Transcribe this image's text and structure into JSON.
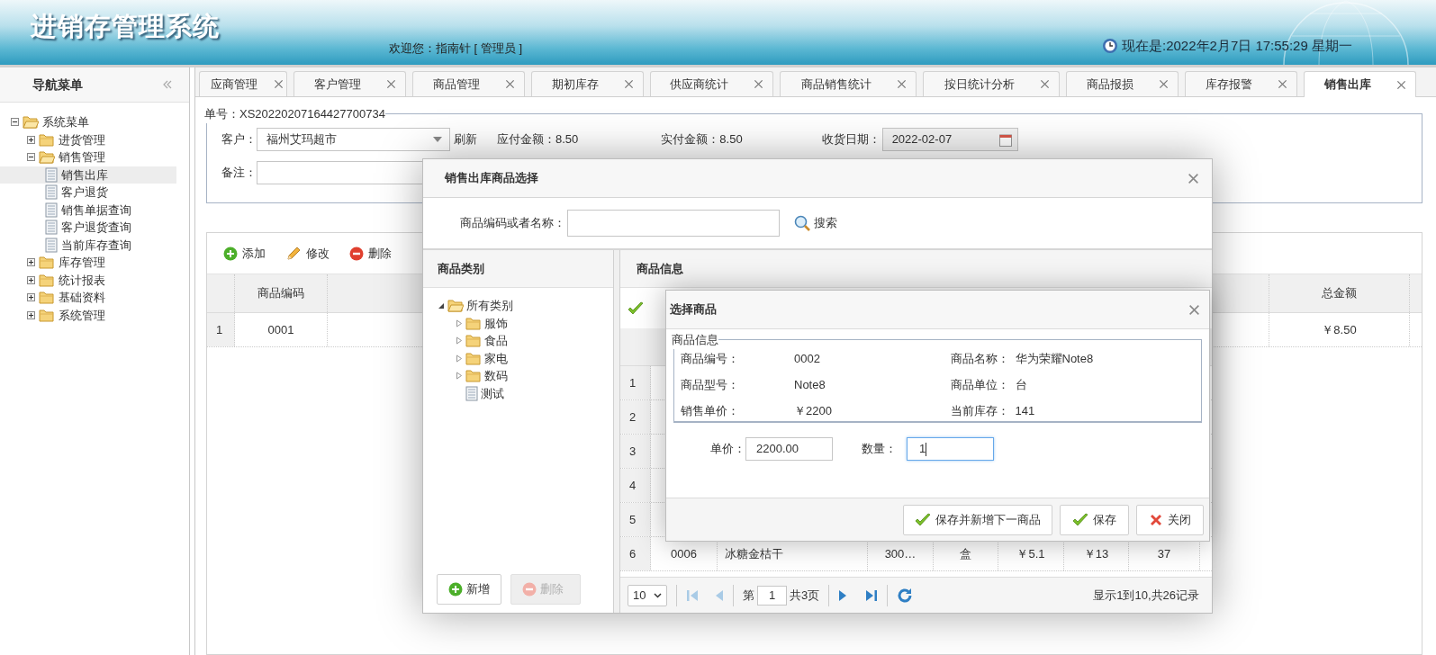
{
  "header": {
    "title": "进销存管理系统",
    "welcome": "欢迎您：指南针 [ 管理员 ]",
    "clock": "现在是:2022年2月7日 17:55:29 星期一"
  },
  "nav": {
    "title": "导航菜单",
    "tree": [
      {
        "label": "系统菜单",
        "kind": "folder",
        "expanded": true,
        "selected": false,
        "children": [
          {
            "label": "进货管理",
            "kind": "folder",
            "expanded": false,
            "selected": false
          },
          {
            "label": "销售管理",
            "kind": "folder",
            "expanded": true,
            "selected": false,
            "children": [
              {
                "label": "销售出库",
                "kind": "page",
                "selected": true
              },
              {
                "label": "客户退货",
                "kind": "page",
                "selected": false
              },
              {
                "label": "销售单据查询",
                "kind": "page",
                "selected": false
              },
              {
                "label": "客户退货查询",
                "kind": "page",
                "selected": false
              },
              {
                "label": "当前库存查询",
                "kind": "page",
                "selected": false
              }
            ]
          },
          {
            "label": "库存管理",
            "kind": "folder",
            "expanded": false,
            "selected": false
          },
          {
            "label": "统计报表",
            "kind": "folder",
            "expanded": false,
            "selected": false
          },
          {
            "label": "基础资料",
            "kind": "folder",
            "expanded": false,
            "selected": false
          },
          {
            "label": "系统管理",
            "kind": "folder",
            "expanded": false,
            "selected": false
          }
        ]
      }
    ]
  },
  "tabs": [
    {
      "label": "应商管理",
      "selected": false
    },
    {
      "label": "客户管理",
      "selected": false
    },
    {
      "label": "商品管理",
      "selected": false
    },
    {
      "label": "期初库存",
      "selected": false
    },
    {
      "label": "供应商统计",
      "selected": false
    },
    {
      "label": "商品销售统计",
      "selected": false
    },
    {
      "label": "按日统计分析",
      "selected": false
    },
    {
      "label": "商品报损",
      "selected": false
    },
    {
      "label": "库存报警",
      "selected": false
    },
    {
      "label": "销售出库",
      "selected": true
    }
  ],
  "form": {
    "legend": "单号：XS20220207164427700734",
    "customer_label": "客户：",
    "customer": "福州艾玛超市",
    "refresh": "刷新",
    "payable": "应付金额：8.50",
    "paid": "实付金额：8.50",
    "date_label": "收货日期：",
    "date": "2022-02-07",
    "remark_label": "备注："
  },
  "toolbar": [
    {
      "label": "添加",
      "kind": "add"
    },
    {
      "label": "修改",
      "kind": "edit"
    },
    {
      "label": "删除",
      "kind": "delete"
    }
  ],
  "grid": {
    "columns": [
      "商品编码",
      "总金额"
    ],
    "rows": [
      {
        "number": "1",
        "cells": [
          "0001",
          "￥8.50"
        ]
      }
    ]
  },
  "dialog": {
    "title": "销售出库商品选择",
    "search_label": "商品编码或者名称：",
    "search_button": "搜索",
    "category": {
      "title": "商品类别",
      "tree": [
        {
          "label": "所有类别",
          "kind": "folder",
          "expanded": true,
          "children": [
            {
              "label": "服饰",
              "kind": "folder",
              "expanded": false
            },
            {
              "label": "食品",
              "kind": "folder",
              "expanded": false
            },
            {
              "label": "家电",
              "kind": "folder",
              "expanded": false
            },
            {
              "label": "数码",
              "kind": "folder",
              "expanded": false
            },
            {
              "label": "测试",
              "kind": "page"
            }
          ]
        }
      ],
      "buttons": [
        {
          "label": "新增",
          "kind": "add",
          "disabled": false
        },
        {
          "label": "删除",
          "kind": "delete",
          "disabled": true
        }
      ]
    },
    "goods": {
      "title": "商品信息",
      "rows": [
        {
          "number": "1"
        },
        {
          "number": "2"
        },
        {
          "number": "3"
        },
        {
          "number": "4"
        },
        {
          "number": "5"
        },
        {
          "number": "6",
          "cells": [
            "0006",
            "冰糖金桔干",
            "300…",
            "盒",
            "￥5.1",
            "￥13",
            "37"
          ]
        }
      ],
      "pager": {
        "page_size": "10",
        "page_label": "第",
        "page": "1",
        "total_pages": "共3页",
        "summary": "显示1到10,共26记录"
      }
    }
  },
  "select_dialog": {
    "title": "选择商品",
    "legend": "商品信息",
    "fields": [
      {
        "label": "商品编号：",
        "value": "0002"
      },
      {
        "label": "商品名称：",
        "value": "华为荣耀Note8"
      },
      {
        "label": "商品型号：",
        "value": "Note8"
      },
      {
        "label": "商品单位：",
        "value": "台"
      },
      {
        "label": "销售单价：",
        "value": "￥2200"
      },
      {
        "label": "当前库存：",
        "value": "141"
      }
    ],
    "price_label": "单价：",
    "price": "2200.00",
    "qty_label": "数量：",
    "qty": "1",
    "buttons": [
      {
        "label": "保存并新增下一商品",
        "kind": "save"
      },
      {
        "label": "保存",
        "kind": "save"
      },
      {
        "label": "关闭",
        "kind": "close"
      }
    ]
  }
}
